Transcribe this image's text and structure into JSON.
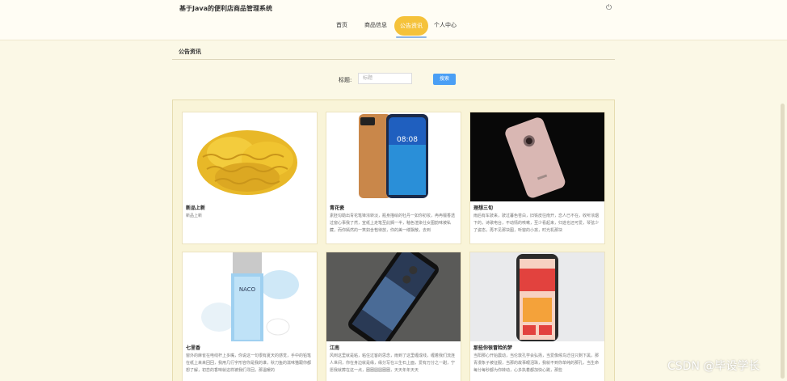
{
  "app": {
    "title": "基于Java的便利店商品管理系统"
  },
  "nav": {
    "items": [
      "首页",
      "商品信息",
      "公告资讯",
      "个人中心"
    ]
  },
  "section": {
    "title": "公告资讯"
  },
  "search": {
    "label": "标题:",
    "placeholder": "标题",
    "button": "搜索"
  },
  "cards": [
    {
      "title": "新品上新",
      "desc": "新品上新"
    },
    {
      "title": "青花瓷",
      "desc": "素胚勾勒出青花笔锋浓转淡，瓶身描绘的牡丹一如你初妆，冉冉檀香透过窗心事我了然，宣纸上走笔至此搁一半，釉色渲染仕女图韵味被私藏，而你嫣然的一笑如含苞待放，你的美一缕飘散，去到"
    },
    {
      "title": "理想三旬",
      "desc": "雨后有车驶来，驶过暮色苍白，旧铁皮往南开，恋人已不在，收听浓烟下的，诗歌电台，不动情的咳嗽，至少看起来，归途也还可爱，琴弦少了姿态，再不见那块图，听窗的小孩，时光机那块"
    },
    {
      "title": "七里香",
      "desc": "窗外的麻雀在电线杆上多嘴，你说这一句很有夏天的感觉，手中的铅笔在纸上来来回回，我用几行字形容你是我的谁，秋刀鱼的滋味猫跟你都想了解，初恋的香味就这样被我们寻回，那温暖的"
    },
    {
      "title": "江南",
      "desc": "风到这里就是粘，粘住过客的思念，雨到了这里缠成线，缠着我们流连人世间，你在身边就是缘，缘分写在三生石上面，爱有万分之一甜，宁愿我就葬在这一点，圈圈圆圆圈圈，天天年年天天"
    },
    {
      "title": "那些你很冒险的梦",
      "desc": "当阳那心开始震动，当伦敦孔学会弘扬，当爱像候鸟迁往只剩下黑，那青漫象子被征服，当那的故事眼泪珠，我就不到你单纯的那孔，当生命每分每秒都为你转动，心多执着都加快心跳，那些"
    }
  ],
  "watermark": "CSDN @毕设学长"
}
